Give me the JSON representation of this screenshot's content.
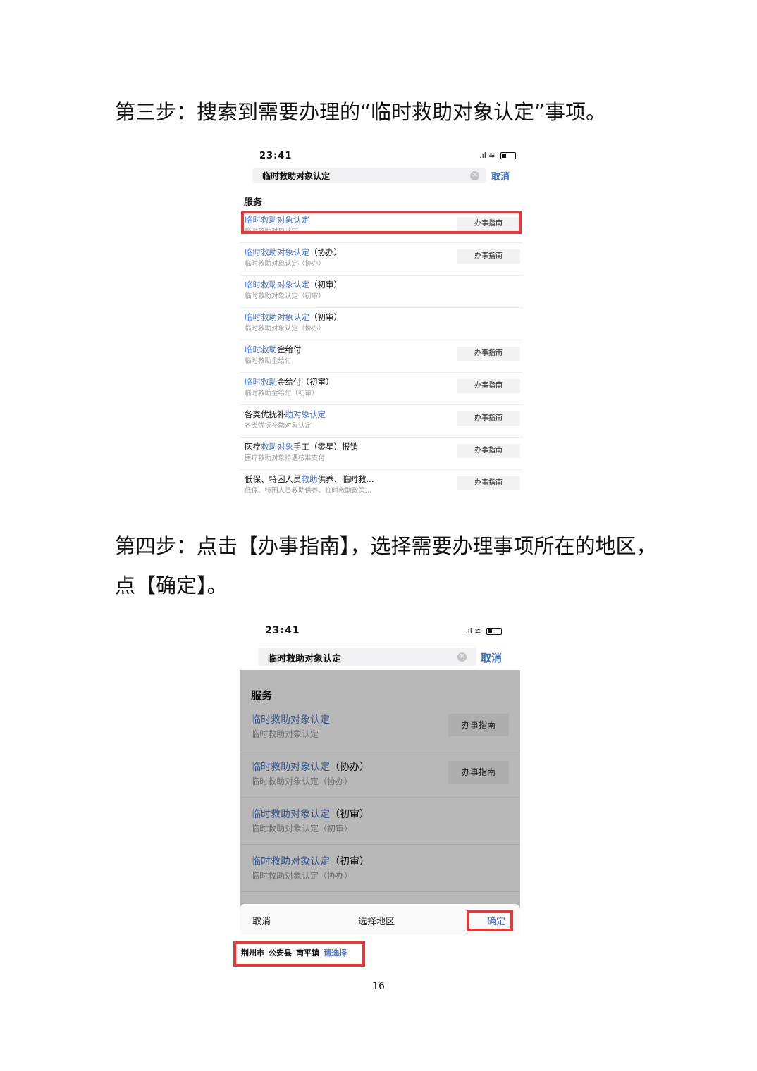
{
  "step3": {
    "title": "第三步：搜索到需要办理的“临时救助对象认定”事项。"
  },
  "step4": {
    "title_line1": "第四步：点击【办事指南】，选择需要办理事项所在的地区，",
    "title_line2": "点【确定】。"
  },
  "shot1": {
    "time": "23:41",
    "search_query": "临时救助对象认定",
    "cancel": "取消",
    "section": "服务",
    "items": [
      {
        "hl": "临时救助对象认定",
        "rest": "",
        "sub": "临时救助对象认定",
        "button": "办事指南"
      },
      {
        "hl": "临时救助对象认定",
        "rest": "（协办）",
        "sub": "临时救助对象认定（协办）",
        "button": "办事指南"
      },
      {
        "hl": "临时救助对象认定",
        "rest": "（初审）",
        "sub": "临时救助对象认定（初审）",
        "button": ""
      },
      {
        "hl": "临时救助对象认定",
        "rest": "（初审）",
        "sub": "临时救助对象认定（协办）",
        "button": ""
      },
      {
        "hl": "临时救助",
        "rest": "金给付",
        "sub": "临时救助金给付",
        "button": "办事指南"
      },
      {
        "hl": "临时救助",
        "rest": "金给付（初审）",
        "sub": "临时救助金给付（初审）",
        "button": "办事指南"
      },
      {
        "pre": "各类优抚补",
        "hl": "助对象认定",
        "rest": "",
        "sub": "各类优抚补助对象认定",
        "button": "办事指南"
      },
      {
        "pre": "医疗",
        "hl": "救助对象",
        "rest": "手工（零星）报销",
        "sub": "医疗救助对象待遇核准支付",
        "button": "办事指南"
      },
      {
        "pre": "低保、特困人员",
        "hl": "救助",
        "rest": "供养、临时救...",
        "sub": "低保、特困人员救助供养、临时救助政策...",
        "button": "办事指南"
      }
    ]
  },
  "shot2": {
    "time": "23:41",
    "search_query": "临时救助对象认定",
    "cancel": "取消",
    "section": "服务",
    "items": [
      {
        "hl": "临时救助对象认定",
        "rest": "",
        "sub": "临时救助对象认定",
        "button": "办事指南"
      },
      {
        "hl": "临时救助对象认定",
        "rest": "（协办）",
        "sub": "临时救助对象认定（协办）",
        "button": "办事指南"
      },
      {
        "hl": "临时救助对象认定",
        "rest": "（初审）",
        "sub": "临时救助对象认定（初审）",
        "button": ""
      },
      {
        "hl": "临时救助对象认定",
        "rest": "（初审）",
        "sub": "临时救助对象认定（协办）",
        "button": ""
      }
    ],
    "sheet": {
      "cancel": "取消",
      "title": "选择地区",
      "confirm": "确定",
      "region": [
        "荆州市",
        "公安县",
        "南平镇"
      ],
      "choose": "请选择"
    }
  },
  "page_number": "16",
  "colors": {
    "link": "#4a76c8",
    "highlight_box": "#e23a3a"
  }
}
